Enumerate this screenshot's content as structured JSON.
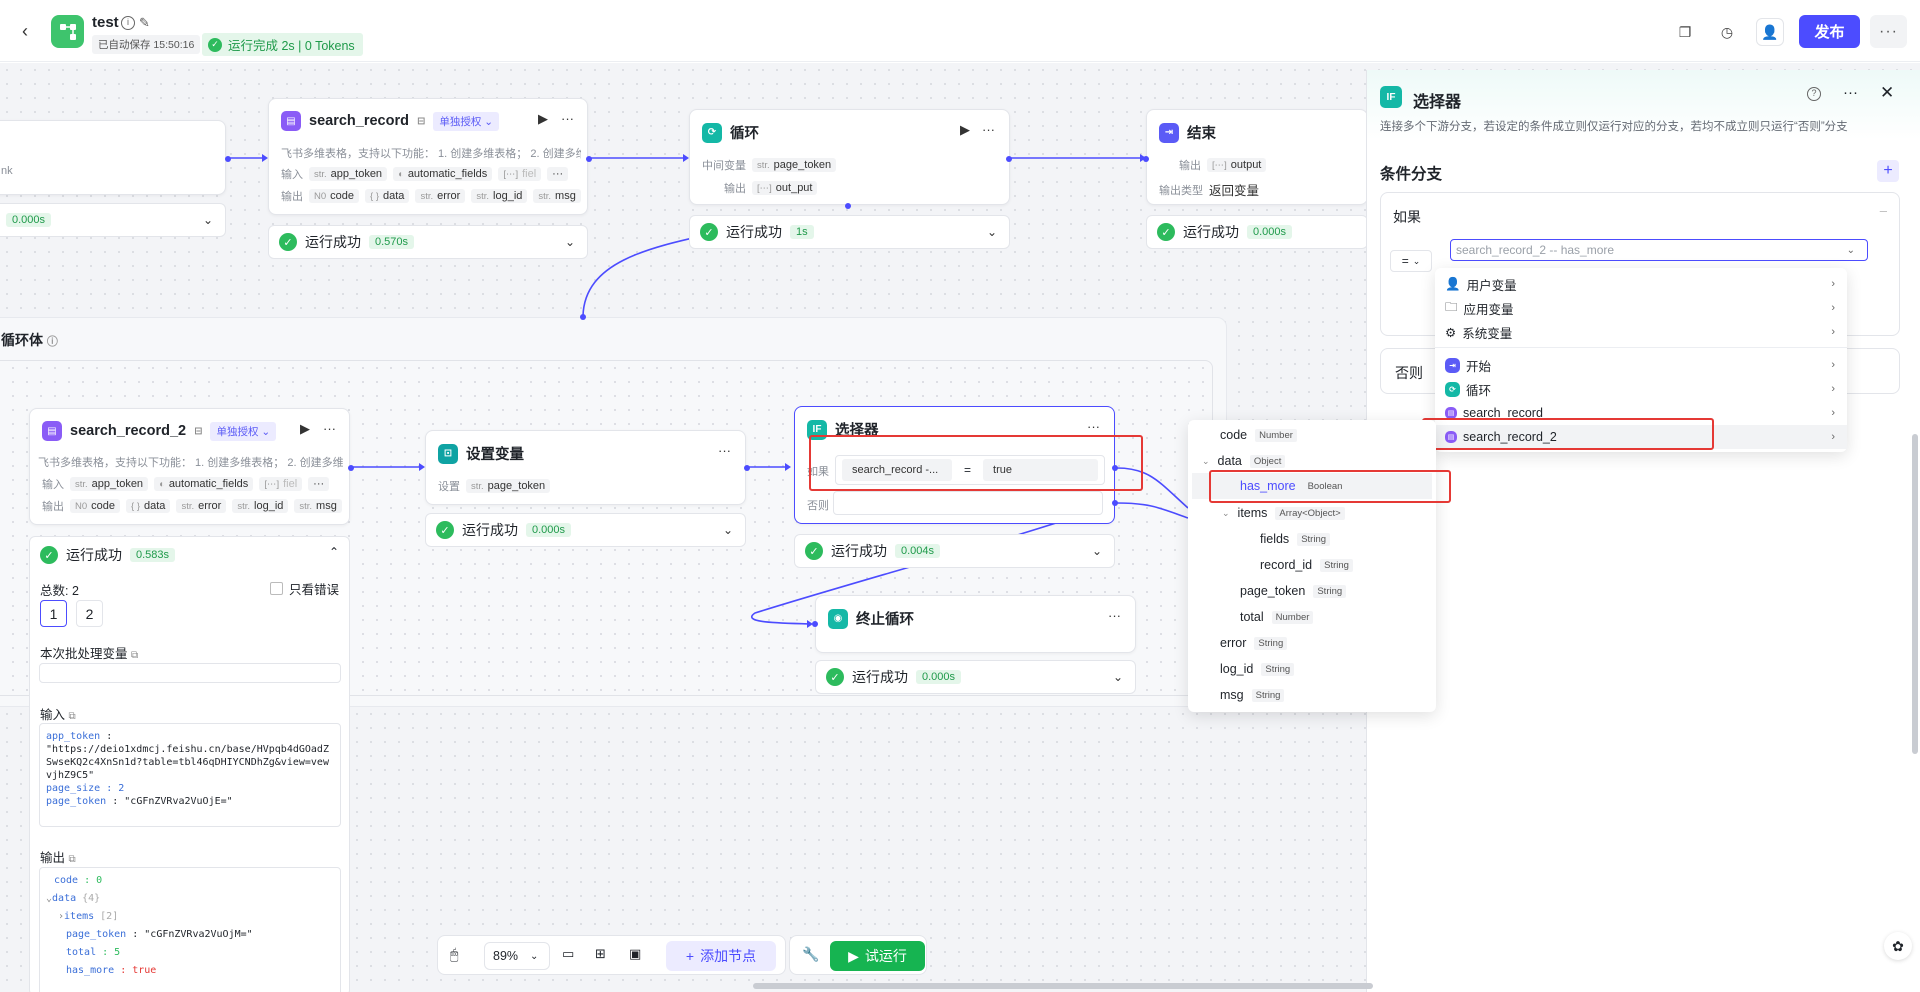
{
  "header": {
    "title": "test",
    "autosave": "已自动保存 15:50:16",
    "run_status": "运行完成 2s | 0 Tokens",
    "publish_label": "发布"
  },
  "nodes": {
    "left_partial": {
      "suffix": "nk",
      "time": "0.000s"
    },
    "search_record": {
      "title": "search_record",
      "auth": "单独授权",
      "desc": "飞书多维表格，支持以下功能：  1. 创建多维表格；  2. 创建多维...",
      "input_label": "输入",
      "inputs": [
        "app_token",
        "automatic_fields",
        "fiel"
      ],
      "output_label": "输出",
      "outputs": [
        [
          "N0",
          "code"
        ],
        [
          "{ }",
          "data"
        ],
        [
          "str.",
          "error"
        ],
        [
          "str.",
          "log_id"
        ],
        [
          "str.",
          "msg"
        ]
      ],
      "status": "运行成功",
      "time": "0.570s"
    },
    "loop": {
      "title": "循环",
      "mid_var_label": "中间变量",
      "mid_var": "page_token",
      "output_label": "输出",
      "output": "out_put",
      "status": "运行成功",
      "time": "1s"
    },
    "end": {
      "title": "结束",
      "output_label": "输出",
      "output": "output",
      "type_label": "输出类型",
      "type_value": "返回变量",
      "status": "运行成功",
      "time": "0.000s"
    },
    "loopbody": {
      "title": "循环体"
    },
    "search_record_2": {
      "title": "search_record_2",
      "auth": "单独授权",
      "desc": "飞书多维表格，支持以下功能：  1. 创建多维表格；  2. 创建多维...",
      "input_label": "输入",
      "inputs": [
        "app_token",
        "automatic_fields",
        "fiel"
      ],
      "output_label": "输出",
      "outputs": [
        [
          "N0",
          "code"
        ],
        [
          "{ }",
          "data"
        ],
        [
          "str.",
          "error"
        ],
        [
          "str.",
          "log_id"
        ],
        [
          "str.",
          "msg"
        ]
      ],
      "status": "运行成功",
      "time": "0.583s",
      "total": "总数: 2",
      "only_errors": "只看错误",
      "pages": [
        "1",
        "2"
      ],
      "batch_var_label": "本次批处理变量",
      "input_section": "输入",
      "input_lines": [
        [
          "app_token",
          " : "
        ],
        [
          "",
          "\"https://deio1xdmcj.feishu.cn/base/HVpqb4dGOadZSwseKQ2c4XnSn1d?table=tbl46qDHIYCNDhZg&view=vewvjhZ9C5\""
        ],
        [
          "page_size",
          " : 2"
        ],
        [
          "page_token",
          " : \"cGFnZVRva2VuOjE=\""
        ]
      ],
      "output_section": "输出",
      "output_lines": [
        [
          "code",
          " : 0"
        ],
        [
          "data",
          " {4}"
        ],
        [
          "items",
          " [2]"
        ],
        [
          "page_token",
          " : \"cGFnZVRva2VuOjM=\""
        ],
        [
          "total",
          " : 5"
        ],
        [
          "has_more",
          " : true"
        ]
      ]
    },
    "set_var": {
      "title": "设置变量",
      "set_label": "设置",
      "var": "page_token",
      "status": "运行成功",
      "time": "0.000s"
    },
    "selector": {
      "title": "选择器",
      "if_label": "如果",
      "cond_left": "search_record -...",
      "op": "=",
      "cond_right": "true",
      "else_label": "否则",
      "status": "运行成功",
      "time": "0.004s"
    },
    "break_loop": {
      "title": "终止循环",
      "status": "运行成功",
      "time": "0.000s"
    }
  },
  "right_panel": {
    "title": "选择器",
    "description": "连接多个下游分支，若设定的条件成立则仅运行对应的分支，若均不成立则只运行“否则”分支",
    "section_title": "条件分支",
    "if_label": "如果",
    "operator": "=",
    "selected_var": "search_record_2 -- has_more",
    "else_label": "否则"
  },
  "dropdown": {
    "items": [
      "用户变量",
      "应用变量",
      "系统变量",
      "开始",
      "循环",
      "search_record",
      "search_record_2"
    ]
  },
  "submenu": {
    "items": [
      {
        "name": "code",
        "type": "Number"
      },
      {
        "name": "data",
        "type": "Object"
      },
      {
        "name": "has_more",
        "type": "Boolean"
      },
      {
        "name": "items",
        "type": "Array<Object>"
      },
      {
        "name": "fields",
        "type": "String"
      },
      {
        "name": "record_id",
        "type": "String"
      },
      {
        "name": "page_token",
        "type": "String"
      },
      {
        "name": "total",
        "type": "Number"
      },
      {
        "name": "error",
        "type": "String"
      },
      {
        "name": "log_id",
        "type": "String"
      },
      {
        "name": "msg",
        "type": "String"
      }
    ]
  },
  "toolbar": {
    "zoom": "89%",
    "add_node": "添加节点",
    "trial_run": "试运行"
  },
  "colors": {
    "accent": "#4c4cff",
    "success": "#2dbb5d",
    "highlight": "#e53935"
  }
}
